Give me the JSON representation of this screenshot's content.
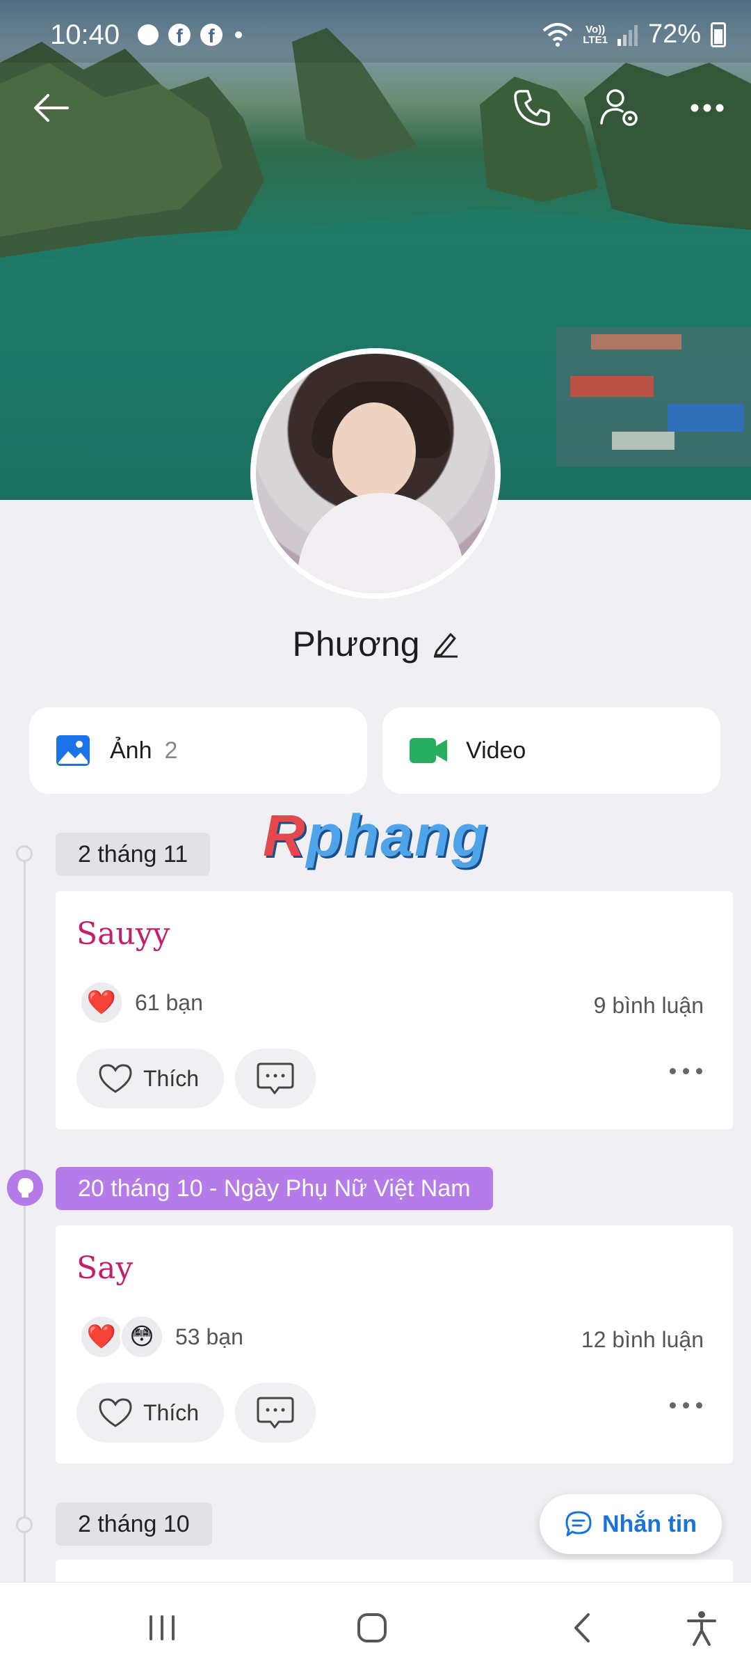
{
  "status_bar": {
    "time": "10:40",
    "battery": "72%",
    "network": "LTE1"
  },
  "header": {
    "back_icon": "arrow-left-icon",
    "call_icon": "phone-icon",
    "settings_icon": "user-settings-icon",
    "more_icon": "more-icon"
  },
  "profile": {
    "name": "Phương",
    "edit_icon": "pencil-icon"
  },
  "media": {
    "photos_label": "Ảnh",
    "photos_count": "2",
    "video_label": "Video",
    "photos_color": "#1a73e8",
    "video_color": "#27ae60"
  },
  "watermark": {
    "prefix": "R",
    "rest": "phang"
  },
  "timeline": [
    {
      "date": "2 tháng 11",
      "post_text": "Sauyy",
      "reactions": [
        "❤️"
      ],
      "reaction_count": "61 bạn",
      "comments": "9 bình luận",
      "like_label": "Thích"
    },
    {
      "date": "20 tháng 10 - Ngày Phụ Nữ Việt Nam",
      "post_text": "Say",
      "reactions": [
        "❤️",
        "😳"
      ],
      "reaction_count": "53 bạn",
      "comments": "12 bình luận",
      "like_label": "Thích"
    },
    {
      "date": "2 tháng 10"
    }
  ],
  "message_button": {
    "label": "Nhắn tin"
  },
  "colors": {
    "accent": "#1a73d9",
    "event": "#b57be8",
    "post_text": "#c41e6a"
  }
}
